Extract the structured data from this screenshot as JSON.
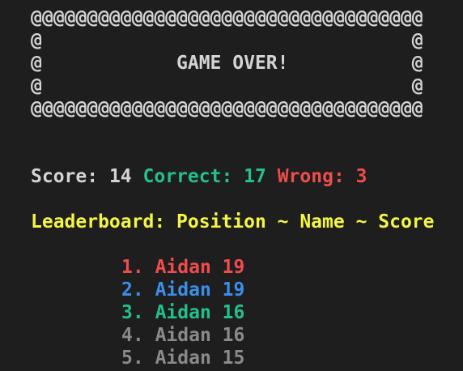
{
  "banner": {
    "top_border": "@@@@@@@@@@@@@@@@@@@@@@@@@@@@@@@@@@@",
    "blank_line_1": "@                                 @",
    "title_line": "@            GAME OVER!           @",
    "blank_line_2": "@                                 @",
    "bottom_border": "@@@@@@@@@@@@@@@@@@@@@@@@@@@@@@@@@@@"
  },
  "stats": {
    "score_label": "Score:",
    "score_value": "14",
    "correct_label": "Correct:",
    "correct_value": "17",
    "wrong_label": "Wrong:",
    "wrong_value": "3"
  },
  "leaderboard": {
    "heading": "Leaderboard: Position ~ Name ~ Score",
    "entries": [
      {
        "position": "1.",
        "name": "Aidan",
        "score": "19",
        "color": "#f14c4c"
      },
      {
        "position": "2.",
        "name": "Aidan",
        "score": "19",
        "color": "#3b8eea"
      },
      {
        "position": "3.",
        "name": "Aidan",
        "score": "16",
        "color": "#23c08e"
      },
      {
        "position": "4.",
        "name": "Aidan",
        "score": "16",
        "color": "#8a8a8a"
      },
      {
        "position": "5.",
        "name": "Aidan",
        "score": "15",
        "color": "#8a8a8a"
      }
    ]
  },
  "colors": {
    "background": "#1e1e1e",
    "text": "#d4d4d4",
    "correct": "#23c08e",
    "wrong": "#f14c4c",
    "heading": "#f5f543"
  }
}
